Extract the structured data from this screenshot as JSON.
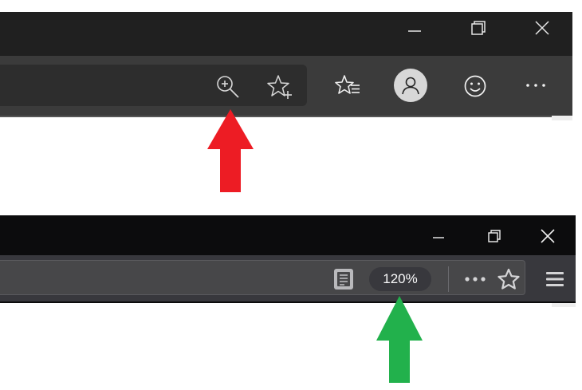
{
  "edge": {
    "window_controls": [
      "minimize",
      "restore",
      "close"
    ],
    "address_icons": [
      "zoom-in-icon",
      "add-to-favorites-icon"
    ],
    "toolbar_icons": [
      "favorites-icon",
      "profile-icon",
      "feedback-icon",
      "more-icon"
    ],
    "colors": {
      "titlebar": "#202020",
      "toolbar": "#3b3b3b",
      "address": "#2d2d2d"
    }
  },
  "firefox": {
    "zoom_level": "120%",
    "page_action_icons": [
      "reader-view-icon",
      "page-actions-icon",
      "bookmark-star-icon"
    ],
    "menu_icon": "hamburger-menu-icon",
    "window_controls": [
      "minimize",
      "restore",
      "close"
    ],
    "colors": {
      "titlebar": "#0c0c0d",
      "toolbar": "#38383d",
      "urlbar": "#474749"
    }
  },
  "annotations": {
    "red_arrow_color": "#ed1c24",
    "green_arrow_color": "#22b14c"
  }
}
